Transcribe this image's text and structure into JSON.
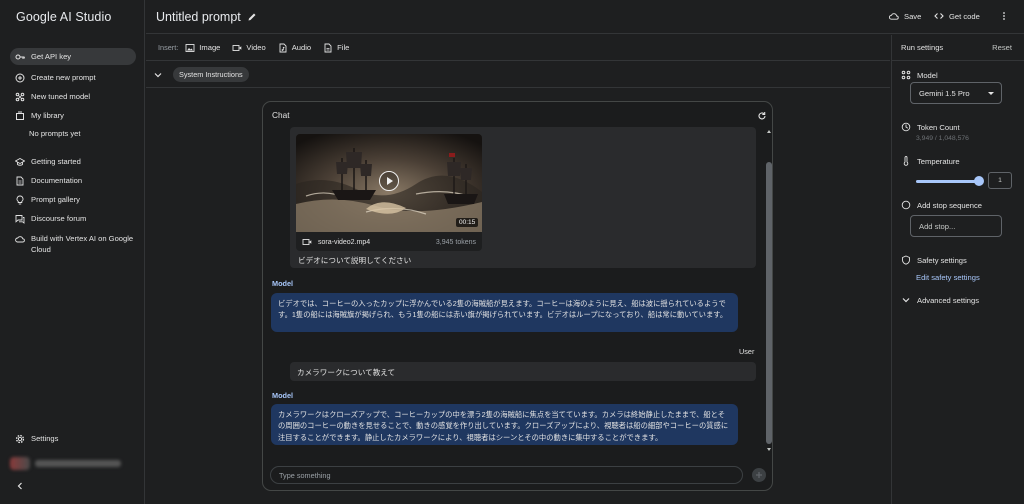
{
  "app": {
    "brand": "Google AI Studio"
  },
  "sidebar": {
    "items": [
      {
        "label": "Get API key",
        "icon": "key-icon"
      },
      {
        "label": "Create new prompt",
        "icon": "plus-circle-icon"
      },
      {
        "label": "New tuned model",
        "icon": "tune-icon"
      },
      {
        "label": "My library",
        "icon": "library-icon"
      },
      {
        "label": "No prompts yet",
        "icon": ""
      },
      {
        "label": "Getting started",
        "icon": "school-icon"
      },
      {
        "label": "Documentation",
        "icon": "document-icon"
      },
      {
        "label": "Prompt gallery",
        "icon": "lightbulb-icon"
      },
      {
        "label": "Discourse forum",
        "icon": "forum-icon"
      },
      {
        "label": "Build with Vertex AI on Google Cloud",
        "icon": "cloud-icon"
      },
      {
        "label": "Settings",
        "icon": "gear-icon"
      }
    ]
  },
  "header": {
    "title": "Untitled prompt",
    "save_label": "Save",
    "get_code_label": "Get code"
  },
  "insert": {
    "label": "Insert:",
    "buttons": [
      "Image",
      "Video",
      "Audio",
      "File"
    ]
  },
  "system": {
    "label": "System Instructions"
  },
  "run_settings": {
    "title": "Run settings",
    "reset": "Reset",
    "model_label": "Model",
    "model_value": "Gemini 1.5 Pro",
    "token_label": "Token Count",
    "token_value": "3,949 / 1,048,576",
    "temperature_label": "Temperature",
    "temperature_value": "1",
    "temperature_fraction": 0.95,
    "stop_label": "Add stop sequence",
    "stop_placeholder": "Add stop...",
    "safety_label": "Safety settings",
    "safety_link": "Edit safety settings",
    "advanced_label": "Advanced settings"
  },
  "chat": {
    "title": "Chat",
    "video": {
      "file_name": "sora-video2.mp4",
      "tokens": "3,945 tokens",
      "duration": "00:15"
    },
    "messages": [
      {
        "role": "User",
        "text": "ビデオについて説明してください"
      },
      {
        "role": "Model",
        "text": "ビデオでは、コーヒーの入ったカップに浮かんでいる2隻の海賊船が見えます。コーヒーは海のように見え、船は波に揺られているようです。1隻の船には海賊旗が掲げられ、もう1隻の船には赤い旗が掲げられています。ビデオはループになっており、船は常に動いています。"
      },
      {
        "role": "User",
        "text": "カメラワークについて教えて"
      },
      {
        "role": "Model",
        "text": "カメラワークはクローズアップで、コーヒーカップの中を漂う2隻の海賊船に焦点を当てています。カメラは終始静止したままで、船とその周囲のコーヒーの動きを見せることで、動きの感覚を作り出しています。クローズアップにより、視聴者は船の細部やコーヒーの質感に注目することができます。静止したカメラワークにより、視聴者はシーンとその中の動きに集中することができます。"
      }
    ],
    "input_placeholder": "Type something"
  }
}
